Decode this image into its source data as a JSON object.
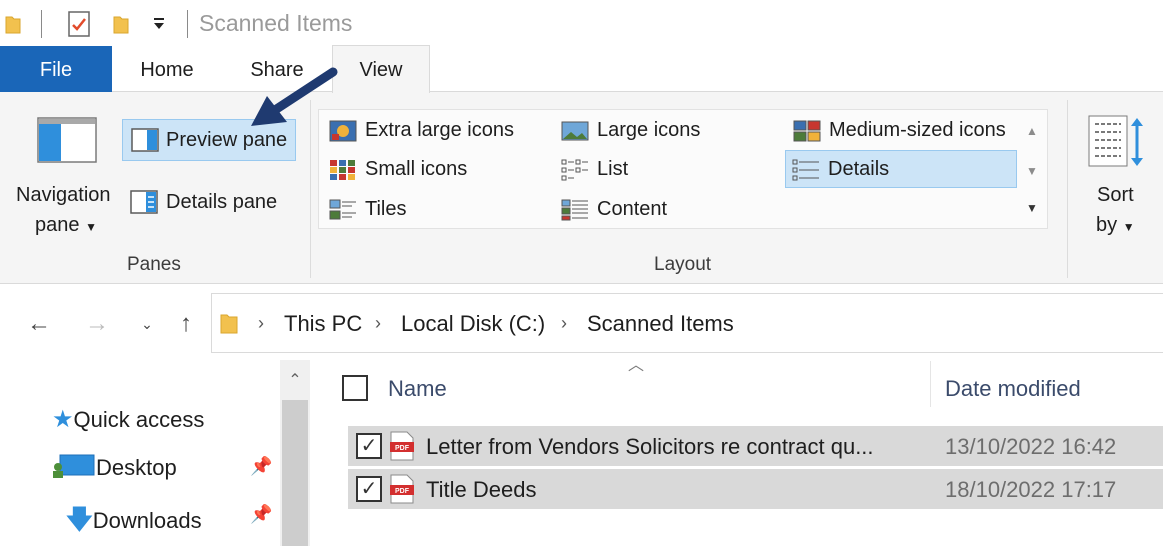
{
  "window": {
    "title": "Scanned Items"
  },
  "tabs": {
    "file": "File",
    "home": "Home",
    "share": "Share",
    "view": "View"
  },
  "ribbon": {
    "panes": {
      "navigation_pane_line1": "Navigation",
      "navigation_pane_line2": "pane",
      "preview_pane": "Preview pane",
      "details_pane": "Details pane",
      "group_label": "Panes"
    },
    "layout": {
      "extra_large_icons": "Extra large icons",
      "large_icons": "Large icons",
      "medium_icons": "Medium-sized icons",
      "small_icons": "Small icons",
      "list": "List",
      "details": "Details",
      "tiles": "Tiles",
      "content": "Content",
      "group_label": "Layout",
      "selected": "Details"
    },
    "sort": {
      "line1": "Sort",
      "line2": "by"
    }
  },
  "breadcrumb": [
    "This PC",
    "Local Disk (C:)",
    "Scanned Items"
  ],
  "nav_pane": {
    "items": [
      {
        "label": "Quick access",
        "icon": "star-icon"
      },
      {
        "label": "Desktop",
        "icon": "desktop-icon",
        "pinned": true
      },
      {
        "label": "Downloads",
        "icon": "download-icon",
        "pinned": true
      }
    ]
  },
  "file_list": {
    "columns": [
      "Name",
      "Date modified"
    ],
    "rows": [
      {
        "name": "Letter from Vendors Solicitors re contract qu...",
        "date": "13/10/2022 16:42",
        "checked": true,
        "type": "PDF"
      },
      {
        "name": "Title Deeds",
        "date": "18/10/2022 17:17",
        "checked": true,
        "type": "PDF"
      }
    ]
  },
  "colors": {
    "accent": "#1a66b8",
    "selection": "#cce4f7",
    "row_selected": "#d9d9d9",
    "annotation_arrow": "#1f3a70"
  }
}
